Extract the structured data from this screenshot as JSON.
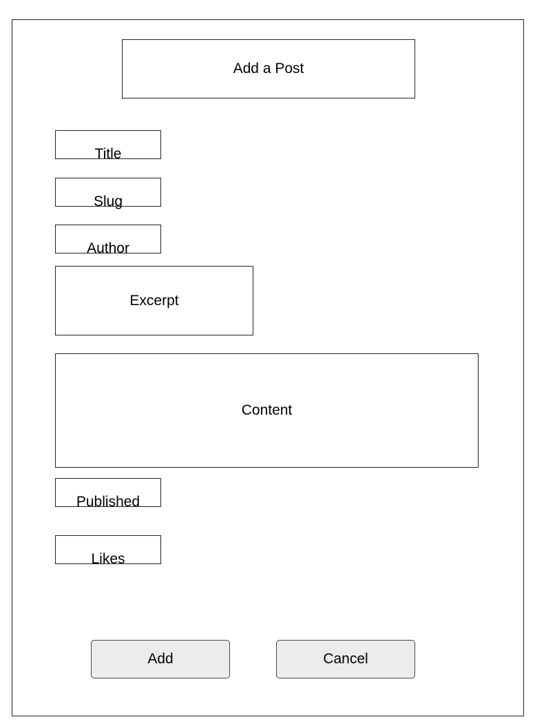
{
  "form": {
    "title": "Add a Post",
    "fields": {
      "title": "Title",
      "slug": "Slug",
      "author": "Author",
      "excerpt": "Excerpt",
      "content": "Content",
      "published": "Published",
      "likes": "Likes"
    },
    "buttons": {
      "add": "Add",
      "cancel": "Cancel"
    }
  }
}
